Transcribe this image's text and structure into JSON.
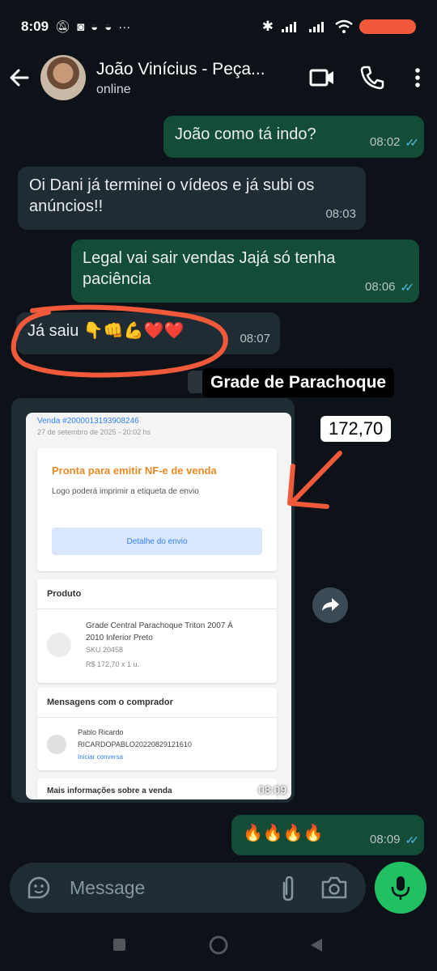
{
  "status_bar": {
    "time": "8:09"
  },
  "header": {
    "contact_name": "João Vinícius - Peça...",
    "contact_status": "online"
  },
  "messages": [
    {
      "direction": "out",
      "text": "João como tá indo?",
      "time": "08:02",
      "read": true
    },
    {
      "direction": "in",
      "text": "Oi Dani já terminei o vídeos e já subi os anúncios!!",
      "time": "08:03"
    },
    {
      "direction": "out",
      "text": "Legal vai sair vendas Jajá só tenha paciência",
      "time": "08:06",
      "read": true
    },
    {
      "direction": "in",
      "text": "Já saiu 👇👊💪❤️❤️",
      "time": "08:07"
    },
    {
      "direction": "out",
      "text": "🔥🔥🔥🔥",
      "time": "08:09",
      "read": true
    }
  ],
  "overlays": {
    "grade_label": "Grade de Parachoque",
    "price_label": "172,70"
  },
  "image_message": {
    "time": "08:09",
    "order_number": "Venda #2000013193908246",
    "order_date": "27 de setembro de 2025 - 20:02 hs",
    "status_title": "Pronta para emitir NF-e de venda",
    "status_subtitle": "Logo poderá imprimir a etiqueta de envio",
    "shipping_button": "Detalhe do envio",
    "product_heading": "Produto",
    "product_name_line1": "Grade Central Parachoque Triton 2007 Á",
    "product_name_line2": "2010 Inferior Preto",
    "product_sku": "SKU 20458",
    "product_price": "R$ 172,70 x 1 u.",
    "messages_heading": "Mensagens com o comprador",
    "buyer_name": "Pablo Ricardo",
    "buyer_username": "RICARDOPABLO20220829121610",
    "start_chat": "Iniciar conversa",
    "more_info": "Mais informações sobre a venda"
  },
  "composer": {
    "placeholder": "Message"
  },
  "colors": {
    "outgoing": "#144d37",
    "incoming": "#1f2c33",
    "accent": "#21c063",
    "annotation": "#f05a3a"
  }
}
